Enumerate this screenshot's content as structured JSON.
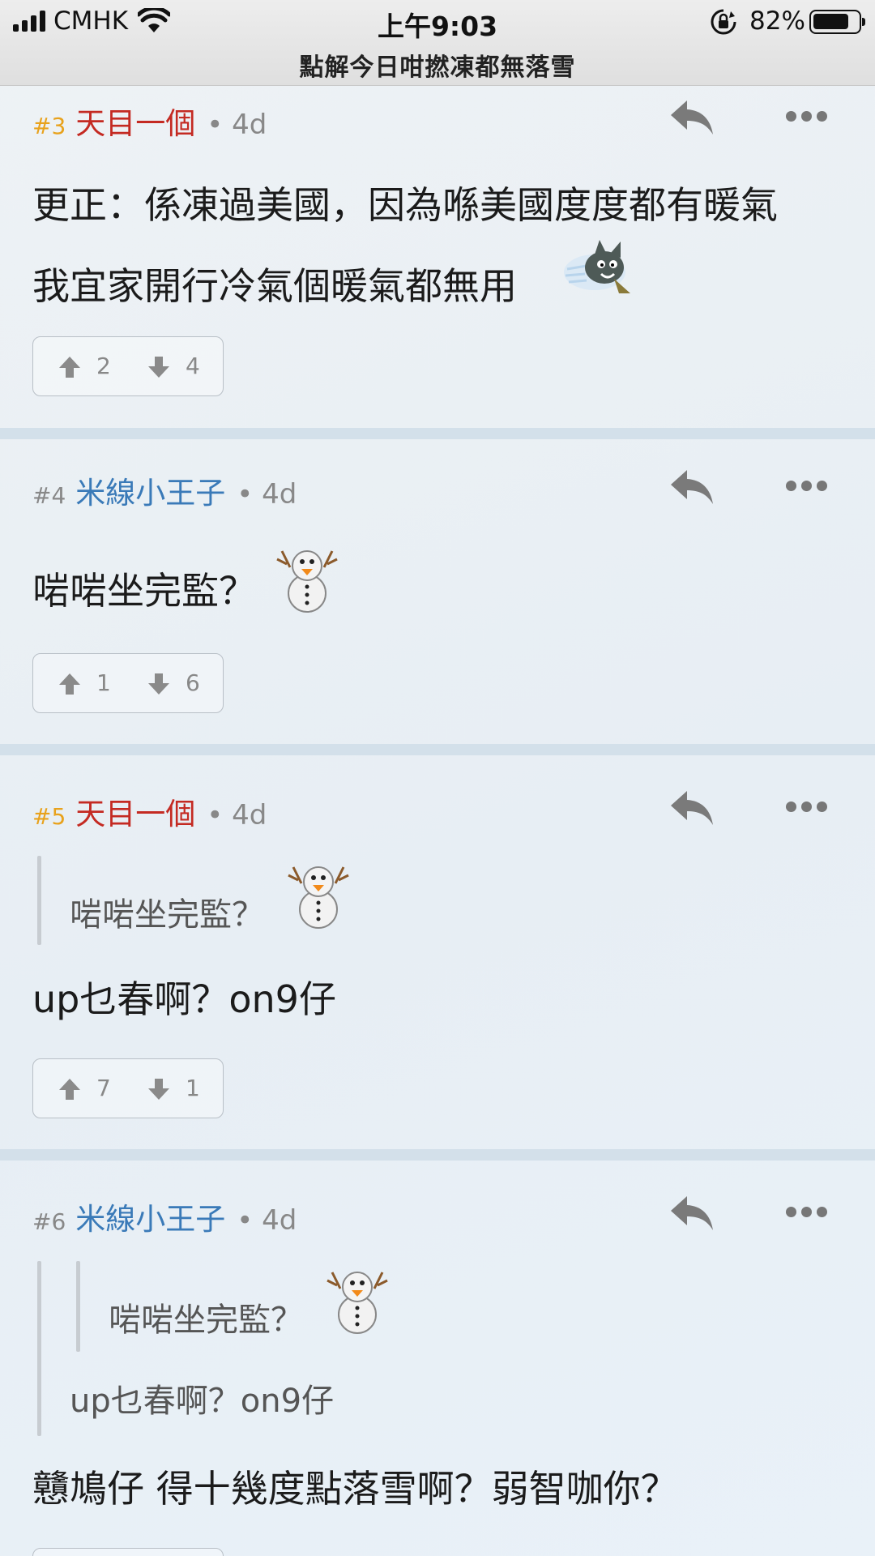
{
  "status_bar": {
    "carrier": "CMHK",
    "time": "上午9:03",
    "battery": "82%",
    "battery_level": 0.82
  },
  "thread": {
    "title": "點解今日咁撚凍都無落雪"
  },
  "posts": [
    {
      "number": "#3",
      "author": "天目一個",
      "time": "• 4d",
      "lines": [
        "更正：係凍過美國，因為喺美國度度都有暖氣",
        "我宜家開行冷氣個暖氣都無用"
      ],
      "emoji": "cold-cat-emoji",
      "upvotes": "2",
      "downvotes": "4"
    },
    {
      "number": "#4",
      "author": "米線小王子",
      "time": "• 4d",
      "lines": [
        "啱啱坐完監？"
      ],
      "emoji": "snowman-emoji",
      "upvotes": "1",
      "downvotes": "6"
    },
    {
      "number": "#5",
      "author": "天目一個",
      "time": "• 4d",
      "quote": "啱啱坐完監？",
      "lines": [
        "up乜春啊？on9仔"
      ],
      "upvotes": "7",
      "downvotes": "1"
    },
    {
      "number": "#6",
      "author": "米線小王子",
      "time": "• 4d",
      "quote_inner": "啱啱坐完監？",
      "quote_outer": "up乜春啊？on9仔",
      "lines": [
        "戇鳩仔 得十幾度點落雪啊？弱智咖你？"
      ]
    }
  ],
  "colors": {
    "gold_number": "#e8a21c",
    "red_author": "#c42a22",
    "blue_author": "#3a7ab8",
    "separator": "#d3e0ea"
  }
}
